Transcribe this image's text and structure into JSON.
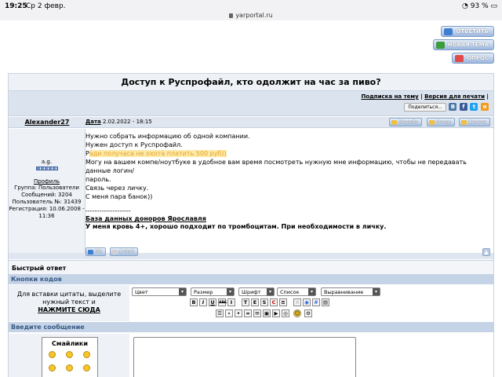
{
  "status_bar": {
    "time": "19:25",
    "date": "Ср 2 февр.",
    "battery": "93 %",
    "url": "yarportal.ru"
  },
  "top_buttons": {
    "reply": "ОТВЕТИТЬ",
    "new_topic": "НОВАЯ ТЕМА",
    "poll": "ОПРОС"
  },
  "topic": {
    "title": "Доступ к Руспрофайл, кто одолжит на час за пиво?",
    "subscribe_link": "Подписка на тему",
    "print_link": "Версия для печати",
    "share_label": "Поделиться..."
  },
  "post": {
    "author": "Alexander27",
    "date_label": "Дата",
    "date": "2.02.2022 - 18:15",
    "buttons": {
      "complaint": "Жалоба",
      "ignore": "Игнор",
      "quote": "Цитата"
    },
    "user": {
      "rank": "a.g.",
      "profile": "Профиль",
      "group": "Группа: Пользователи",
      "messages": "Сообщений: 3204",
      "user_no": "Пользователь №: 31439",
      "registered_1": "Регистрация: 10.06.2008 -",
      "registered_2": "11:36"
    },
    "lines": [
      "Нужно собрать информацию об одной компании.",
      "Нужен доступ к Руспрофайл."
    ],
    "highlight_prefix": "Р",
    "highlight": "ади получаса не охота платить 500 руб))",
    "lines2": [
      "Могу на вашем компе/ноутбуке в удобное вам время посмотреть нужную мне информацию, чтобы не передавать данные логин/",
      "пароль.",
      "Связь через личку.",
      "С меня пара банок))"
    ],
    "sig_divider": "--------------------",
    "sig_line1": "База данных доноров Ярославля",
    "sig_line2": "У меня кровь 4+, хорошо подходит по тромбоцитам. При необходимости в личку.",
    "footer_buttons": {
      "pm": "PM",
      "email": "E-Mail"
    }
  },
  "quick_reply": {
    "title": "Быстрый ответ",
    "codes_header": "Кнопки кодов",
    "codes_hint_1": "Для вставки цитаты, выделите",
    "codes_hint_2": "нужный текст и",
    "codes_hint_3": "НАЖМИТЕ СЮДА",
    "selects": [
      "Цвет",
      "Размер",
      "Шрифт",
      "Список",
      "Выравнивание"
    ],
    "format_buttons": [
      "B",
      "I",
      "U",
      "ABC",
      "I",
      "T",
      "E",
      "S",
      "C"
    ],
    "message_header": "Введите сообщение",
    "smilies_title": "Смайлики"
  },
  "colors": {
    "accent": "#c4d3e6",
    "header_text": "#3a5a85",
    "highlight": "#fde9a8"
  }
}
